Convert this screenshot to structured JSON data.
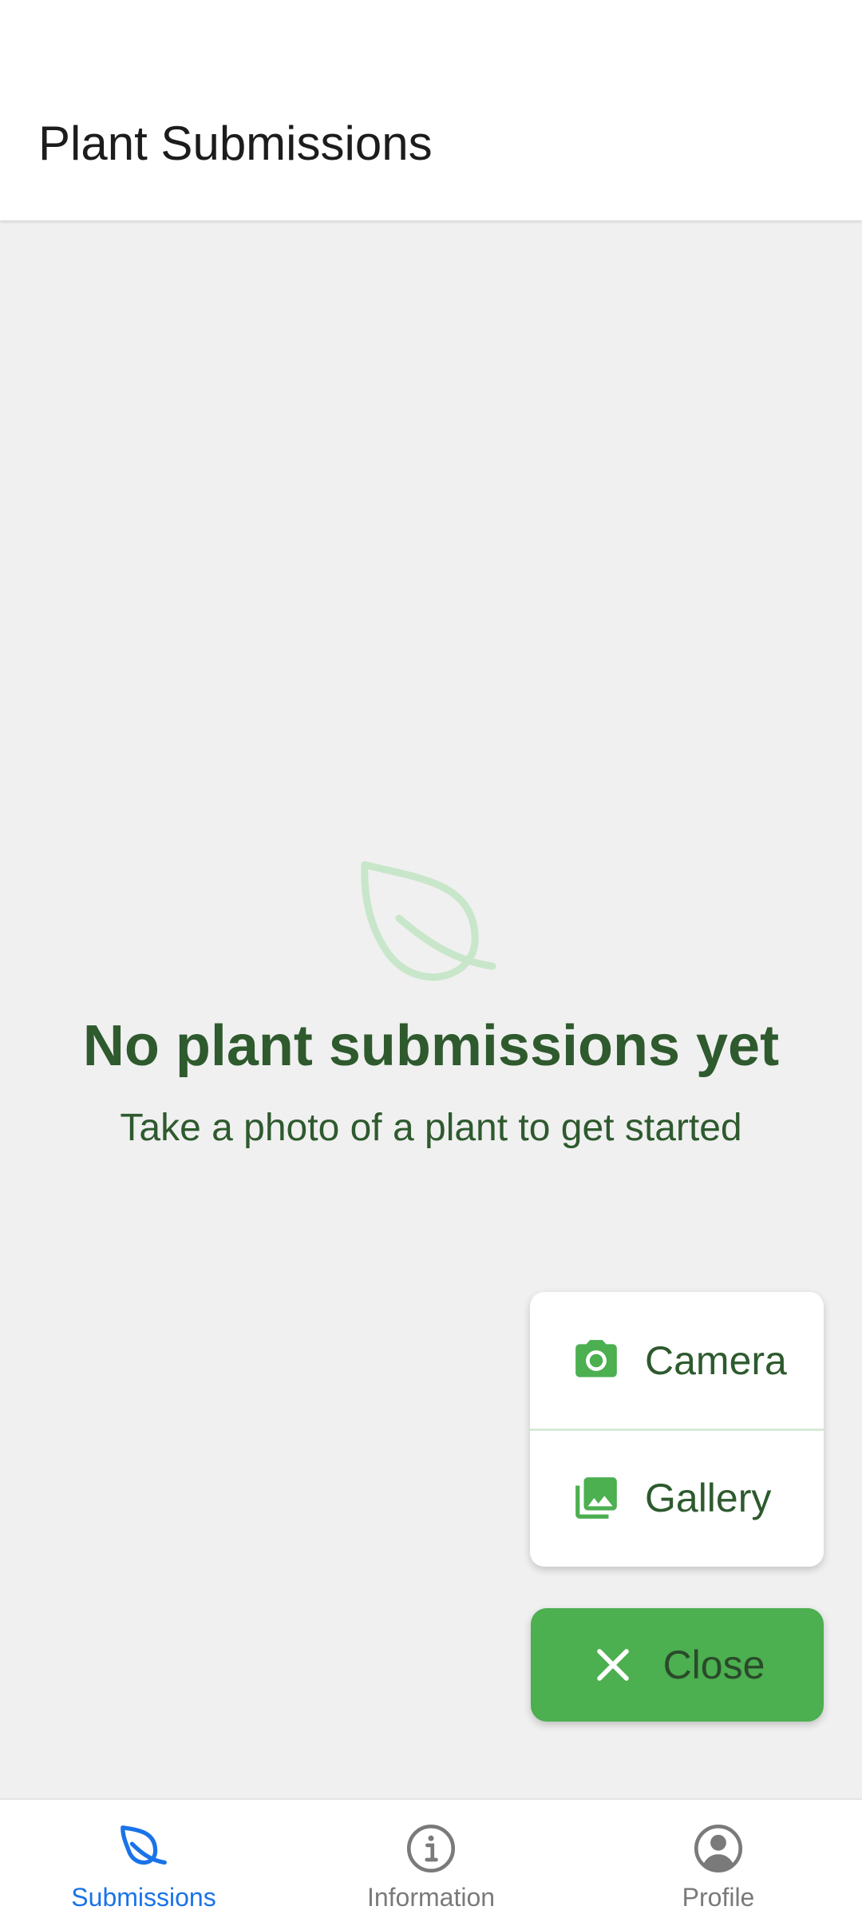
{
  "header": {
    "title": "Plant Submissions"
  },
  "empty_state": {
    "icon": "leaf-icon",
    "title": "No plant submissions yet",
    "subtitle": "Take a photo of a plant to get started"
  },
  "fab_menu": {
    "items": [
      {
        "label": "Camera",
        "icon": "camera-icon"
      },
      {
        "label": "Gallery",
        "icon": "gallery-icon"
      }
    ],
    "close": {
      "label": "Close",
      "icon": "close-icon"
    }
  },
  "bottom_nav": {
    "items": [
      {
        "label": "Submissions",
        "icon": "leaf-icon",
        "active": true
      },
      {
        "label": "Information",
        "icon": "info-icon",
        "active": false
      },
      {
        "label": "Profile",
        "icon": "account-circle-icon",
        "active": false
      }
    ]
  },
  "colors": {
    "primary_green": "#4caf50",
    "dark_green_text": "#2e5a2e",
    "active_nav": "#1a73e8",
    "inactive_nav": "#7a7a7a",
    "background": "#f0f0f0"
  }
}
